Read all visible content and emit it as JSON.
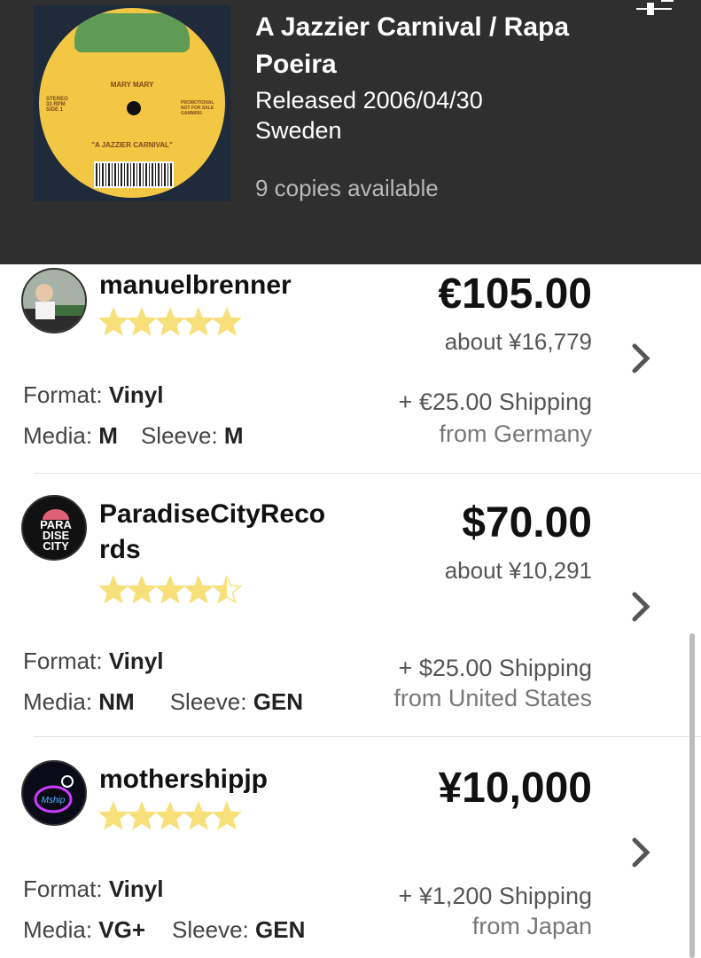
{
  "release": {
    "title": "A Jazzier Carnival / Rapa Poeira",
    "released": "Released 2006/04/30",
    "country": "Sweden",
    "copies": "9 copies available",
    "cover_label": {
      "top": "MARY MARY",
      "left": "STEREO\n33 RPM\nSIDE 1",
      "right": "PROMOTIONAL\nNOT FOR SALE\nGAMM091",
      "bottom": "\"A JAZZIER CARNIVAL\""
    }
  },
  "listings": [
    {
      "seller": "manuelbrenner",
      "rating_stars": 5,
      "price": "€105.00",
      "about": "about ¥16,779",
      "format_label": "Format:",
      "format": "Vinyl",
      "media_label": "Media:",
      "media": "M",
      "sleeve_label": "Sleeve:",
      "sleeve": "M",
      "shipping": "+ €25.00 Shipping",
      "from": "from Germany"
    },
    {
      "seller": "ParadiseCityReco\nrds",
      "rating_stars": 4.5,
      "price": "$70.00",
      "about": "about ¥10,291",
      "format_label": "Format:",
      "format": "Vinyl",
      "media_label": "Media:",
      "media": "NM",
      "sleeve_label": "Sleeve:",
      "sleeve": "GEN",
      "shipping": "+ $25.00 Shipping",
      "from": "from United States",
      "avatar_text": "PARA\nDISE\nCITY"
    },
    {
      "seller": "mothershipjp",
      "rating_stars": 5,
      "price": "¥10,000",
      "about": "",
      "format_label": "Format:",
      "format": "Vinyl",
      "media_label": "Media:",
      "media": "VG+",
      "sleeve_label": "Sleeve:",
      "sleeve": "GEN",
      "shipping": "+ ¥1,200 Shipping",
      "from": "from Japan"
    }
  ],
  "icons": {
    "filter": "sliders-icon",
    "chevron": "chevron-right-icon",
    "star": "star-icon"
  },
  "colors": {
    "header_bg": "#2f2f2f",
    "star_fill": "#f7e07a"
  }
}
